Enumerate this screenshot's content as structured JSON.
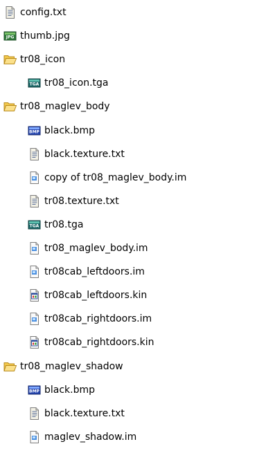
{
  "tree": {
    "items": [
      {
        "label": "config.txt",
        "icon": "text-file-icon",
        "indent": 0,
        "type": "file"
      },
      {
        "label": "thumb.jpg",
        "icon": "jpg-image-icon",
        "indent": 0,
        "type": "file"
      },
      {
        "label": "tr08_icon",
        "icon": "folder-open-icon",
        "indent": 0,
        "type": "folder"
      },
      {
        "label": "tr08_icon.tga",
        "icon": "tga-image-icon",
        "indent": 1,
        "type": "file"
      },
      {
        "label": "tr08_maglev_body",
        "icon": "folder-open-icon",
        "indent": 0,
        "type": "folder"
      },
      {
        "label": "black.bmp",
        "icon": "bmp-image-icon",
        "indent": 1,
        "type": "file"
      },
      {
        "label": "black.texture.txt",
        "icon": "text-file-icon",
        "indent": 1,
        "type": "file"
      },
      {
        "label": "copy of tr08_maglev_body.im",
        "icon": "im-file-icon",
        "indent": 1,
        "type": "file"
      },
      {
        "label": "tr08.texture.txt",
        "icon": "text-file-icon",
        "indent": 1,
        "type": "file"
      },
      {
        "label": "tr08.tga",
        "icon": "tga-image-icon",
        "indent": 1,
        "type": "file"
      },
      {
        "label": "tr08_maglev_body.im",
        "icon": "im-file-icon",
        "indent": 1,
        "type": "file"
      },
      {
        "label": "tr08cab_leftdoors.im",
        "icon": "im-file-icon",
        "indent": 1,
        "type": "file"
      },
      {
        "label": "tr08cab_leftdoors.kin",
        "icon": "kin-file-icon",
        "indent": 1,
        "type": "file"
      },
      {
        "label": "tr08cab_rightdoors.im",
        "icon": "im-file-icon",
        "indent": 1,
        "type": "file"
      },
      {
        "label": "tr08cab_rightdoors.kin",
        "icon": "kin-file-icon",
        "indent": 1,
        "type": "file"
      },
      {
        "label": "tr08_maglev_shadow",
        "icon": "folder-open-icon",
        "indent": 0,
        "type": "folder"
      },
      {
        "label": "black.bmp",
        "icon": "bmp-image-icon",
        "indent": 1,
        "type": "file"
      },
      {
        "label": "black.texture.txt",
        "icon": "text-file-icon",
        "indent": 1,
        "type": "file"
      },
      {
        "label": "maglev_shadow.im",
        "icon": "im-file-icon",
        "indent": 1,
        "type": "file"
      }
    ]
  }
}
